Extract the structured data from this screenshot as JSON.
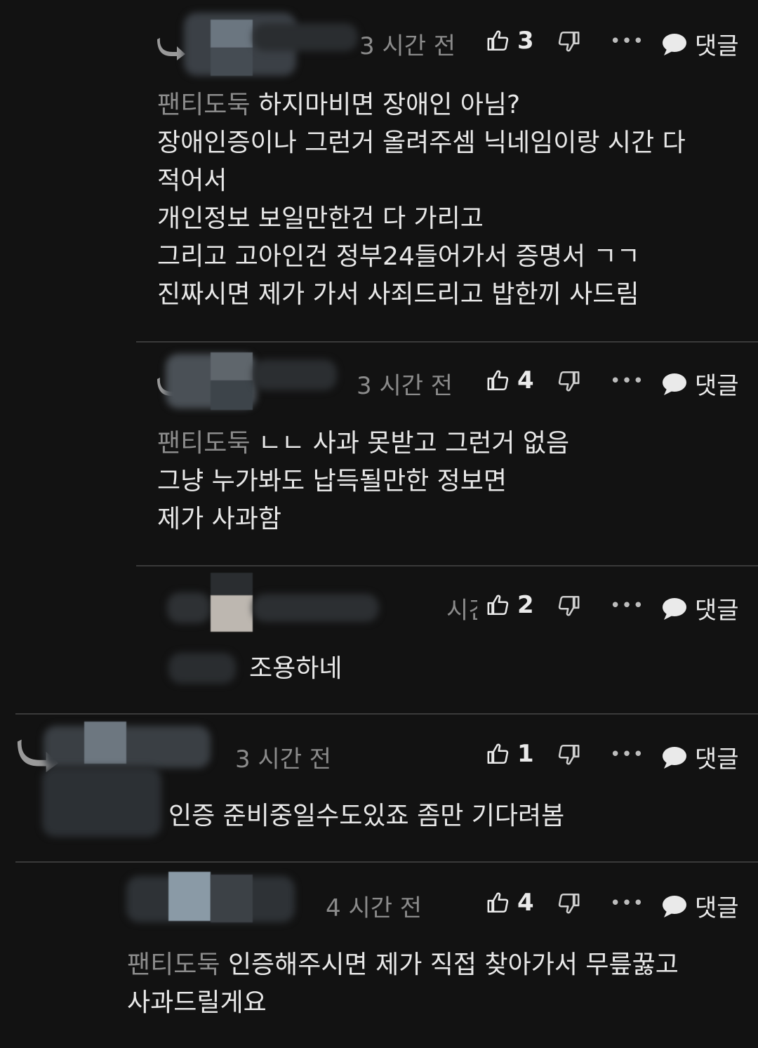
{
  "colors": {
    "background": "#121212",
    "text": "#e8e8e8",
    "muted": "#8c8c8c",
    "divider": "#3a3a3a"
  },
  "icons": {
    "like": "thumbs-up-icon",
    "dislike": "thumbs-down-icon",
    "more": "more-dots-icon",
    "reply": "speech-bubble-icon",
    "reply_arrow": "reply-arrow-icon"
  },
  "actions": {
    "more_label": "•••",
    "reply_label": "댓글"
  },
  "comments": [
    {
      "time": "3 시간 전",
      "likes": "3",
      "mention": "팬티도둑",
      "text": "하지마비면 장애인 아님?\n장애인증이나 그런거 올려주셈 닉네임이랑 시간 다\n적어서\n개인정보 보일만한건 다 가리고\n그리고 고아인건 정부24들어가서 증명서 ㄱㄱ\n진짜시면 제가 가서 사죄드리고 밥한끼 사드림"
    },
    {
      "time": "3 시간 전",
      "likes": "4",
      "mention": "팬티도둑",
      "text": "ㄴㄴ 사과 못받고 그런거 없음\n그냥 누가봐도 납득될만한 정보면\n제가 사과함"
    },
    {
      "time": "시긴",
      "likes": "2",
      "mention": "",
      "text": "조용하네"
    },
    {
      "time": "3 시간 전",
      "likes": "1",
      "mention": "",
      "text": "인증 준비중일수도있죠 좀만 기다려봄"
    },
    {
      "time": "4 시간 전",
      "likes": "4",
      "mention": "팬티도둑",
      "text": "인증해주시면 제가 직접 찾아가서 무릎꿇고\n사과드릴게요"
    }
  ]
}
